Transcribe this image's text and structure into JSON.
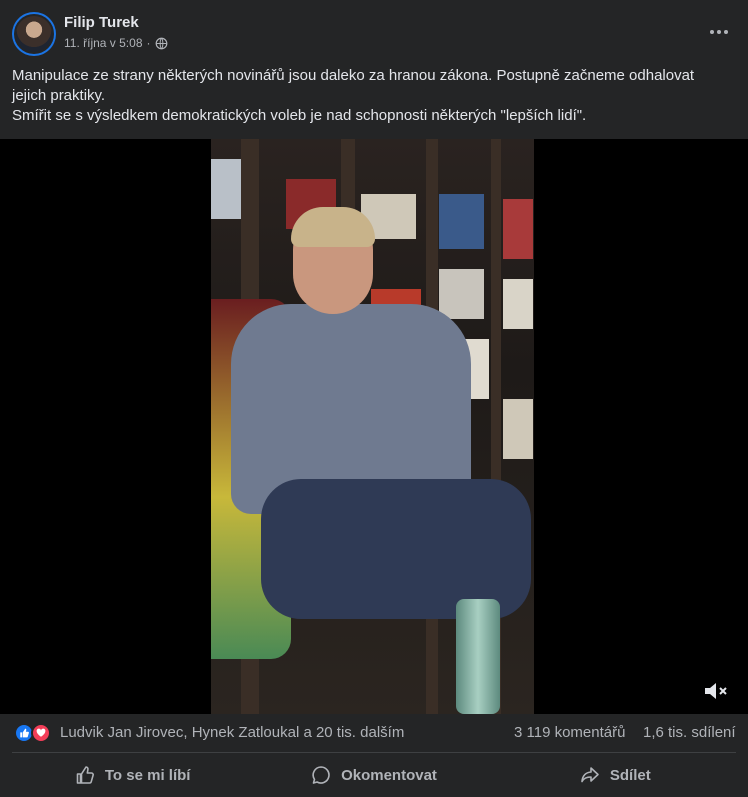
{
  "post": {
    "author": "Filip Turek",
    "timestamp": "11. října v 5:08",
    "separator": "·",
    "privacy_icon": "globe-icon",
    "text_line1": "Manipulace ze strany některých novinářů jsou daleko za hranou zákona. Postupně začneme odhalovat jejich praktiky.",
    "text_line2": "Smířit se s výsledkem demokratických voleb je nad schopnosti některých \"lepších lidí\"."
  },
  "reactions": {
    "icons": [
      "like-icon",
      "love-icon"
    ],
    "names": "Ludvik Jan Jirovec, Hynek Zatloukal a 20 tis. dalším",
    "comments": "3 119 komentářů",
    "shares": "1,6 tis. sdílení"
  },
  "actions": {
    "like": "To se mi líbí",
    "comment": "Okomentovat",
    "share": "Sdílet"
  },
  "colors": {
    "background": "#242526",
    "text": "#e4e6eb",
    "secondary_text": "#b0b3b8",
    "like_blue": "#1877f2",
    "love_red": "#f33e58"
  }
}
